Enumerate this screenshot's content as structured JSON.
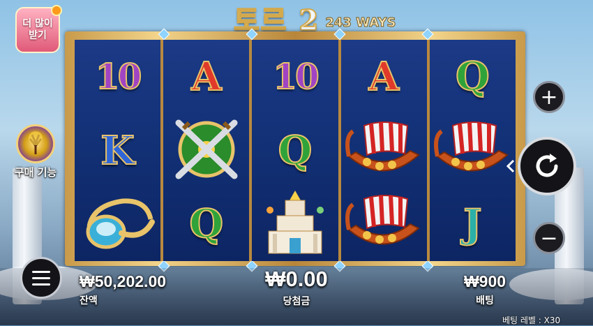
{
  "game": {
    "title": "토르 2",
    "ways": "243 WAYS"
  },
  "buttons": {
    "more": "더 많이 받기",
    "buy_feature": "구매 기능"
  },
  "icons": {
    "plus": "+",
    "minus": "−",
    "spin": "↻"
  },
  "reels": [
    [
      {
        "label": "10",
        "type": "ten"
      },
      {
        "label": "K",
        "type": "k"
      },
      {
        "label": "",
        "type": "horn"
      }
    ],
    [
      {
        "label": "A",
        "type": "a"
      },
      {
        "label": "",
        "type": "shield-swords"
      },
      {
        "label": "Q",
        "type": "q"
      }
    ],
    [
      {
        "label": "10",
        "type": "ten"
      },
      {
        "label": "Q",
        "type": "q"
      },
      {
        "label": "",
        "type": "temple"
      }
    ],
    [
      {
        "label": "A",
        "type": "a"
      },
      {
        "label": "",
        "type": "viking-ship"
      },
      {
        "label": "",
        "type": "viking-ship"
      }
    ],
    [
      {
        "label": "Q",
        "type": "q"
      },
      {
        "label": "",
        "type": "viking-ship"
      },
      {
        "label": "J",
        "type": "j"
      }
    ]
  ],
  "status": {
    "balance_value": "₩50,202.00",
    "balance_label": "잔액",
    "win_value": "₩0.00",
    "win_label": "당첨금",
    "bet_value": "₩900",
    "bet_label": "배팅",
    "bet_level": "베팅 레벨 : X30"
  },
  "colors": {
    "reel_bg": "#123075",
    "frame_gold": "#e2bd6a"
  }
}
